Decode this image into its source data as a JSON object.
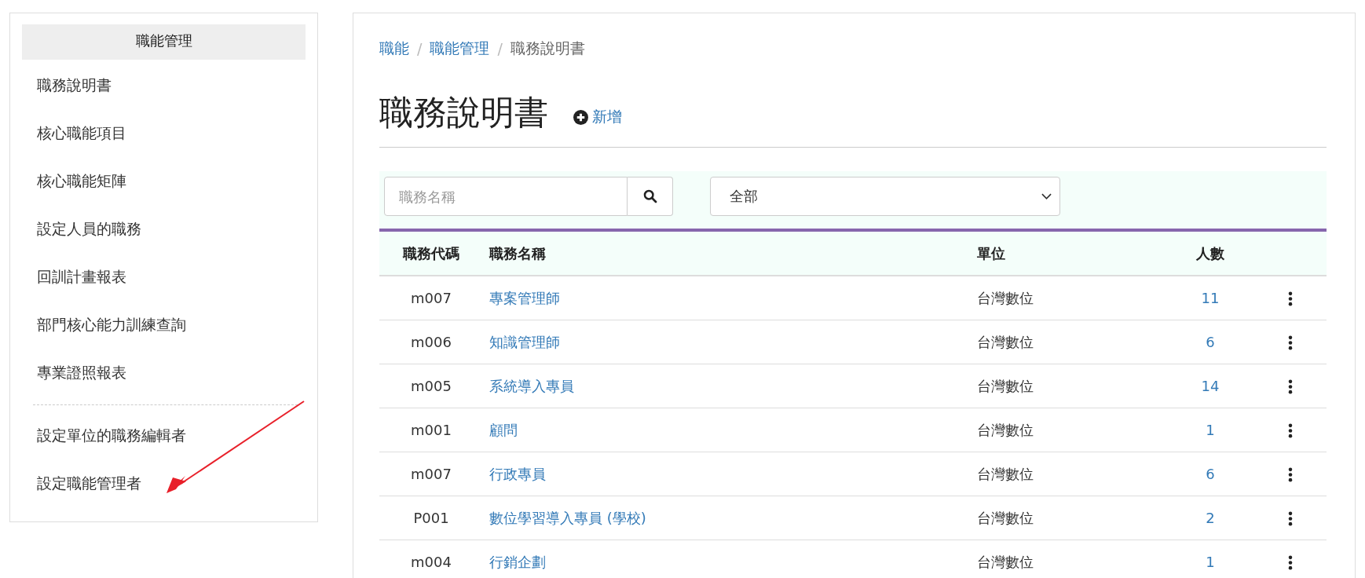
{
  "sidebar": {
    "title": "職能管理",
    "items": [
      {
        "label": "職務說明書"
      },
      {
        "label": "核心職能項目"
      },
      {
        "label": "核心職能矩陣"
      },
      {
        "label": "設定人員的職務"
      },
      {
        "label": "回訓計畫報表"
      },
      {
        "label": "部門核心能力訓練查詢"
      },
      {
        "label": "專業證照報表"
      }
    ],
    "admin_items": [
      {
        "label": "設定單位的職務編輯者"
      },
      {
        "label": "設定職能管理者"
      }
    ]
  },
  "breadcrumb_separator": "/",
  "breadcrumb": [
    {
      "label": "職能",
      "kind": "link"
    },
    {
      "label": "職能管理",
      "kind": "link"
    },
    {
      "label": "職務說明書",
      "kind": "current"
    }
  ],
  "page_title": "職務說明書",
  "add_link": "新增",
  "search": {
    "placeholder": "職務名稱"
  },
  "filter_select": {
    "value": "全部"
  },
  "table": {
    "columns": [
      "職務代碼",
      "職務名稱",
      "單位",
      "人數"
    ],
    "rows": [
      {
        "code": "m007",
        "name": "專案管理師",
        "unit": "台灣數位",
        "count": "11"
      },
      {
        "code": "m006",
        "name": "知識管理師",
        "unit": "台灣數位",
        "count": "6"
      },
      {
        "code": "m005",
        "name": "系統導入專員",
        "unit": "台灣數位",
        "count": "14"
      },
      {
        "code": "m001",
        "name": "顧問",
        "unit": "台灣數位",
        "count": "1"
      },
      {
        "code": "m007",
        "name": "行政專員",
        "unit": "台灣數位",
        "count": "6"
      },
      {
        "code": "P001",
        "name": "數位學習導入專員 (學校)",
        "unit": "台灣數位",
        "count": "2"
      },
      {
        "code": "m004",
        "name": "行銷企劃",
        "unit": "台灣數位",
        "count": "1"
      }
    ]
  }
}
